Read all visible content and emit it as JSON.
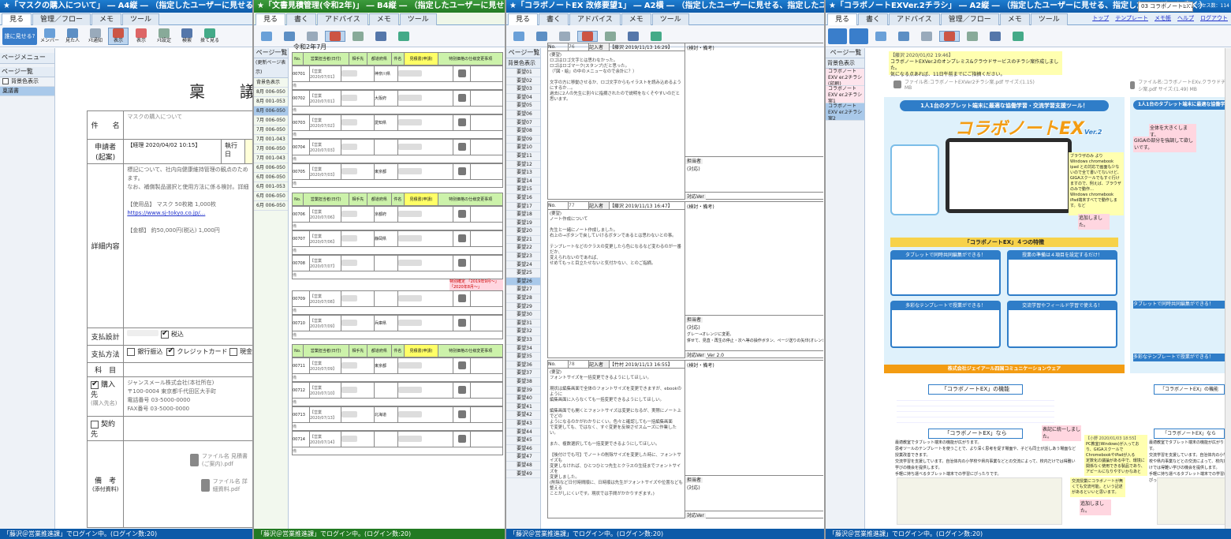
{
  "pane1": {
    "title": "★「マスクの購入について」 ― A4縦 ― （指定したユーザーに見せる、誰とも書か",
    "tabs": [
      "見る",
      "管理／フロー",
      "メモ",
      "ツール"
    ],
    "toolbar": [
      "誰に見せる?",
      "メンバー",
      "見た人",
      "ﾒﾓ通知",
      "文字の回転",
      "表示",
      "ﾒﾓ設定",
      "検索",
      "捨て見る"
    ],
    "side_header": "ページメニュー",
    "side_sub": "ページ一覧",
    "side_items": [
      "背景色表示",
      "稟議書"
    ],
    "doc_title": "稟　議　書",
    "form": {
      "r1_label": "件　　名",
      "r1_value": "マスクの購入について",
      "r2_label": "申請者(起案)",
      "r2_value": "【経理 2020/04/02 10:15】",
      "r2_extra": "執行日",
      "r3_label": "詳細内容",
      "r3_lines": [
        "標記について、社内向健康維持管理の観点のため",
        "ます。",
        "なお、補償製品選択と使用方法に係る検討。詳細",
        "",
        "【使用品】 マスク 50枚箱 1,000枚",
        "https://www.sj-tokyo.co.jp/...",
        "",
        "【金額】 約50,000円(税込) 1,000円"
      ],
      "r4_label": "支払設計",
      "r4_value": "税込",
      "r5_label": "支払方法",
      "r5_opts": [
        "銀行振込",
        "クレジットカード",
        "現金"
      ],
      "r6_label": "科　目",
      "r7_label": "購入先",
      "r7_sub": "(購入先名)",
      "r7_lines": [
        "ジャンスメール株式会社(本社所在)",
        "〒100-0004 東京都千代田区大手町",
        "電話番号 03-5000-0000",
        "FAX番号 03-5000-0000"
      ],
      "r8_label": "契約先",
      "r9_label": "備　考",
      "r9_sub": "(添付資料)",
      "attach1": "ファイル名 見積書(ご案内).pdf",
      "attach2": "ファイル名 詳細資料.pdf"
    },
    "status": "「藤沢＠営業推進課」でログイン中。(ログイン数:20)"
  },
  "pane2": {
    "title": "★「文書見積管理(令和2年)」 ― B4縦 ― （指定したユーザーに見せる、指定したユーザーと書く）",
    "tabs": [
      "見る",
      "書く",
      "アドバイス",
      "メモ",
      "ツール"
    ],
    "side_header": "ページ一覧",
    "side_sub": "(更新ページ表示)",
    "side_items": [
      "背景色表示",
      "8月 006-050",
      "8月 001-053",
      "8月 006-050",
      "7月 006-050",
      "7月 006-050",
      "7月 001-043",
      "7月 006-050",
      "7月 001-043",
      "6月 006-050",
      "6月 006-050",
      "6月 001-053",
      "6月 006-050",
      "6月 006-050"
    ],
    "page_title": "令和2年7月",
    "headers": [
      "No.",
      "営業担当者(日付)",
      "相手先",
      "都道府県",
      "件名",
      "見積書(申請)",
      "特別価格の仕様変更事項"
    ],
    "rows": [
      [
        "00701",
        "【営業 2020/07/01】",
        "",
        "神奈川県",
        ""
      ],
      [
        "00702",
        "【営業 2020/07/01】",
        "",
        "大阪府",
        ""
      ],
      [
        "00703",
        "【営業 2020/07/02】",
        "",
        "愛知県",
        ""
      ],
      [
        "00704",
        "【営業 2020/07/03】",
        "",
        "",
        ""
      ],
      [
        "00705",
        "【営業 2020/07/03】",
        "",
        "東京都",
        ""
      ],
      [
        "00706",
        "【営業 2020/07/06】",
        "",
        "京都府",
        ""
      ],
      [
        "00707",
        "【営業 2020/07/06】",
        "",
        "静岡県",
        ""
      ],
      [
        "00708",
        "【営業 2020/07/07】",
        "",
        "",
        ""
      ],
      [
        "00709",
        "【営業 2020/07/08】",
        "",
        "",
        ""
      ],
      [
        "00710",
        "【営業 2020/07/09】",
        "",
        "兵庫県",
        ""
      ],
      [
        "00711",
        "【営業 2020/07/09】",
        "",
        "東京都",
        ""
      ],
      [
        "00712",
        "【営業 2020/07/10】",
        "",
        "",
        ""
      ],
      [
        "00713",
        "【営業 2020/07/13】",
        "",
        "北海道",
        ""
      ],
      [
        "00714",
        "【営業 2020/07/14】",
        "",
        "",
        ""
      ]
    ],
    "note": "特別確定 「2019年9月～」「2020年8月～」",
    "status": "「藤沢＠営業推進課」でログイン中。(ログイン数:20)"
  },
  "pane3": {
    "title": "★「コラボノートEX 改修要望1」 ― A2横 ― （指定したユーザーに見せる、指定したユーザーと書く）",
    "tabs": [
      "見る",
      "書く",
      "アドバイス",
      "メモ",
      "ツール"
    ],
    "side_header": "ページ一覧",
    "side_sub": "背景色表示",
    "side_items": [
      "要望01",
      "要望02",
      "要望03",
      "要望04",
      "要望05",
      "要望06",
      "要望07",
      "要望08",
      "要望09",
      "要望10",
      "要望11",
      "要望12",
      "要望13",
      "要望14",
      "要望15",
      "要望16",
      "要望17",
      "要望18",
      "要望19",
      "要望20",
      "要望21",
      "要望22",
      "要望23",
      "要望24",
      "要望25",
      "要望26",
      "要望27",
      "要望28",
      "要望29",
      "要望30",
      "要望31",
      "要望32",
      "要望33",
      "要望34",
      "要望35",
      "要望36",
      "要望37",
      "要望38",
      "要望39",
      "要望40",
      "要望41",
      "要望42",
      "要望43",
      "要望44",
      "要望45",
      "要望46",
      "要望47",
      "要望48",
      "要望49"
    ],
    "entries": [
      {
        "no": "76",
        "by": "記入者",
        "who": "【藤沢 2019/11/13 16:29】",
        "h": "(要望)",
        "body": [
          "ロゴはロゴ文字とは思わなかった。",
          "ロゴはロゴマーク(スタンプ)だと思った。",
          "（「図・絵」の中のメニューなので余計に？）",
          "",
          "文字の方に移動させるか、ロゴ文字からもイラストを読み込めるようにするか…。",
          "過去に2人の先生に別々に指摘されたので説明をなくそやすいのだと思います。"
        ],
        "right": "(検討・備考)",
        "resp": "担当者",
        "resp2": "(対応)",
        "ver": "対応Ver"
      },
      {
        "no": "77",
        "by": "記入者",
        "who": "【藤沢 2019/11/13 16:47】",
        "h": "(要望)",
        "body": [
          "ノート作成について",
          "",
          "先生と一緒にノート作成しました。",
          "右上の→ボタンで戻していけるボタンであるとは思わないとの事。",
          "",
          "テンプレートなどのクラスの変更したら色になるなど変わるのが一番だか、",
          "変えられないのであれば、",
          "せめてもっと目立たせないと気付かない、とのご指摘。"
        ],
        "right": "(検討・備考)",
        "resp": "担当者",
        "resp2": "(対応)",
        "resp3": "グレー→オレンジに変更。",
        "resp4": "併せて、見直・再生の停止・次へ等の操作ボタン、ページ送りの矢印(オレンジ)の配置も変更",
        "ver": "対応Ver",
        "vernum": "Ver 2.0",
        "nav": "次へ",
        "pages": [
          "1",
          "2",
          "3",
          "4",
          "5",
          "6"
        ]
      },
      {
        "no": "78",
        "by": "記入者",
        "who": "【竹村 2019/11/13 16:55】",
        "h": "(要望)",
        "body": [
          "フォントサイズを一括変更できるようにしてほしい。",
          "",
          "現状は編集画面で全体のフォントサイズを変更できますが、ebookのように",
          "編集画面に入らなくても一括変更できるようにしてほしい。",
          "",
          "編集画面でも開くとフォントサイズは変更になるが、実際にノート上でどの",
          "ようになるのかがわかりにくい。色々と確認しても一括編集画面",
          "で変更しても、ではなく、すぐ変更を反映させスムーズに作業したい。",
          "",
          "また、複数選択しても一括変更できるようにしてほしい。",
          "",
          "【後付けでも可】でノートの削除サイズを変更した時に、フォントサイズも",
          "変更しなければ、ひとつひとつ先生とクラスの生徒までフォントサイズを",
          "変更しました。",
          "(削除など日付時間順に、日時順は先生がフォントサイズや位置なども整える",
          "ことがしにくいです。現状では手間がかかりすぎます。)"
        ],
        "right": "(検討・備考)",
        "resp": "担当者",
        "resp2": "(対応)",
        "ver": "対応Ver"
      }
    ],
    "status": "「藤沢＠営業推進課」でログイン中。(ログイン数:20)"
  },
  "pane4": {
    "title": "★「コラボノートEXVer.2チラシ」 ― A2縦 ― （指定したユーザーに見せる、指定したユーザーと書く）",
    "tabs": [
      "見る",
      "書く",
      "アドバイス",
      "管理／フロー",
      "メモ",
      "ツール"
    ],
    "right_links": [
      "トップ",
      "テンプレート",
      "メモ帳",
      "ヘルプ",
      "ログアウト"
    ],
    "select": "03 コラボノートEXVer.2チラ…",
    "access": "本日アクセス数：114",
    "side_header": "ページ一覧",
    "side_sub": "背景色表示",
    "side_items": [
      "コラボノートEXV er.2チラシ(印刷)",
      "コラボノートEXV er.2チラシ案1",
      "コラボノートEXV er.2チラシ案2"
    ],
    "memo": [
      "【藤沢 2020/01/02 19:46】",
      "コラボノートEXVer.2のオンプレミス&クラウドサービスのチラシ案作成しました。",
      "気になる点あれば、11日午前までにご指摘ください。"
    ],
    "file1": "ファイル名:コラボノートEXVer2チラシ案.pdf サイズ:(1.15) MB",
    "file2": "ファイル名:コラボノートEXv.クラウドチラシ案.pdf サイズ:(1.49) MB",
    "flyer_head": "1人1台のタブレット端末に最適な協働学習・交流学習支援ツール！",
    "flyer_logo": "コラボノートEX",
    "flyer_ver": "Ver.2",
    "features_title": "「コラボノートEX」４つの特徴",
    "f1": "タブレットで同時共同編集ができる！",
    "f2": "授業の準備は４項目を設定するだけ！",
    "f3": "多彩なテンプレートで授業ができる！",
    "f4": "交流学習やフィールド学習で使える！",
    "company": "株式会社ジェイアール四国コミュニケーションウェア",
    "functions_title": "「コラボノートEX」の機能",
    "nara_title": "「コラボノートEX」なら",
    "nara_items": [
      "最適教室でタブレット端末の機能が広がります。",
      "思考ツールのテンプレートを使うことで、より深く思考を促す場面や、子ども同士が話しあう場面など授業改善できます。",
      "交流学習を支援しています。自治体内の小学校や県内事業などとの交流によって、校内だけでは得難い学びの機会を提供します。",
      "手軽に持ち運べるタブレット端末での学習にぴったりです。"
    ],
    "sticky1": [
      "ブラウザのみ より",
      "Windows chromebook ipad との対応で画面も少ないので全て書いてないけど、GIGAスクールでもすぐ行けますので、例えば、ブラウザのみで動作…",
      "Windows chromebook iPad端末すべてで動作します。など"
    ],
    "sticky2": "全体を大きくします。",
    "sticky3": "GIGAの部分を強調して欲しいです。",
    "sticky4": "追加しました。",
    "sticky5": [
      "【小野 2020/01/03 18:55】",
      "PC教室(Windows)が入っており、GIGAスクールでChromebookやiPadが入る",
      "定数化の議論がある中で、環境に関係なく使用できる製品であり、アピールになりやすいかなあと"
    ],
    "sticky6": "交流授業にコラボノートが無くても交流可能。という記述があるといいと思います。",
    "sticky7": "追加しました。",
    "sticky8": "表記に統一しました。",
    "status": "「藤沢＠営業推進課」でログイン中。(ログイン数:20)"
  }
}
